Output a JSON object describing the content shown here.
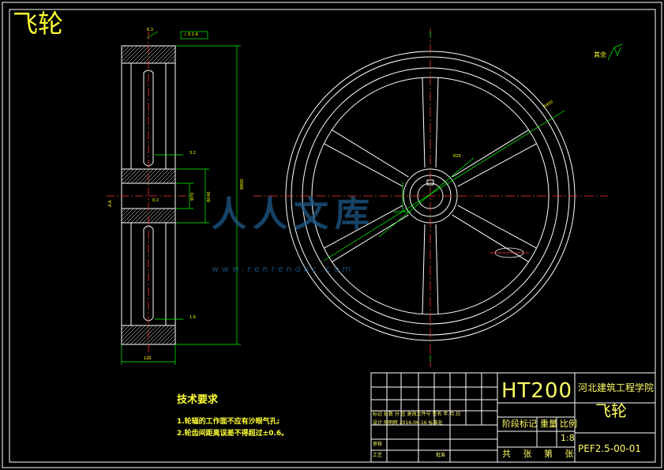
{
  "drawing": {
    "title": "飞轮",
    "roughness_note": "其余"
  },
  "tech_requirements": {
    "heading": "技术要求",
    "items": [
      "1.轮辐的工作面不应有沙眼气孔;",
      "2.轮齿间距离误差不得超过±0.6。"
    ]
  },
  "title_block": {
    "material": "HT200",
    "school": "河北建筑工程学院",
    "part_name": "飞轮",
    "stage_label": "阶段标记",
    "weight_label": "重量",
    "scale_label": "比例",
    "scale": "1:8",
    "sheets_label": "共 张 第 张",
    "drawing_no": "PEF2.5-00-01",
    "revision_header": "标记 处数 分 区 更改文件号 签名 年.月.日",
    "design_row": "设计 何明辉 2016-06-16 标准化",
    "review_label": "审核",
    "process_label": "工艺",
    "approve_label": "批准"
  },
  "dimensions": {
    "d_total": "Φ800",
    "width": "120",
    "hub_dia": "Φ240",
    "bore": "Φ70",
    "rim": "R20",
    "radius_note": "R400",
    "tol": "0.2",
    "section_mark": "A-A",
    "gd_t": "⊥ 0.1 A",
    "ra1": "3.2",
    "ra2": "1.6",
    "ra3": "6.3"
  },
  "watermark": {
    "text": "人人文库",
    "url": "www.renrendoc.com"
  },
  "colors": {
    "background": "#000000",
    "line": "#ffffff",
    "dimension": "#00ff00",
    "center": "#ff0000",
    "text": "#ffff33"
  }
}
